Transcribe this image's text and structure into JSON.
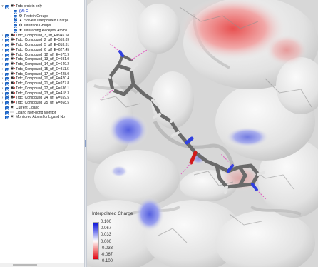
{
  "tree": {
    "rows": [
      {
        "label": "Trdc protein only",
        "twisty": "▾",
        "indent": 0,
        "icon": "ligand-icon",
        "checked": true
      },
      {
        "label": "(M) E",
        "twisty": "›",
        "indent": 1,
        "icon": "",
        "checked": true,
        "highlight": true
      },
      {
        "label": "Protein Groups",
        "twisty": "›",
        "indent": 1,
        "icon": "group-icon",
        "checked": true
      },
      {
        "label": "Solvent Interpolated Charge",
        "twisty": "",
        "indent": 1,
        "icon": "surface-icon",
        "checked": true
      },
      {
        "label": "Interface Groups",
        "twisty": "›",
        "indent": 1,
        "icon": "group-icon",
        "checked": true
      },
      {
        "label": "Interacting Receptor Atoms",
        "twisty": "",
        "indent": 1,
        "icon": "atoms-icon",
        "checked": true
      },
      {
        "label": "Trdc_Compound_3_uff_E=945.58",
        "twisty": "›",
        "indent": 0,
        "icon": "ligand-icon",
        "checked": true
      },
      {
        "label": "Trdc_Compound_2_uff_E=553.89",
        "twisty": "›",
        "indent": 0,
        "icon": "ligand-icon",
        "checked": true
      },
      {
        "label": "Trdc_Compound_5_uff_E=818.31",
        "twisty": "›",
        "indent": 0,
        "icon": "ligand-icon",
        "checked": true
      },
      {
        "label": "Trdc_Compound_6_uff_E=627.45",
        "twisty": "›",
        "indent": 0,
        "icon": "ligand-icon",
        "checked": true
      },
      {
        "label": "Trdc_Compound_12_uff_E=575.9",
        "twisty": "›",
        "indent": 0,
        "icon": "ligand-icon",
        "checked": true
      },
      {
        "label": "Trdc_Compound_13_uff_E=931.0",
        "twisty": "›",
        "indent": 0,
        "icon": "ligand-icon",
        "checked": true
      },
      {
        "label": "Trdc_Compound_14_uff_E=649.2",
        "twisty": "›",
        "indent": 0,
        "icon": "ligand-icon",
        "checked": true
      },
      {
        "label": "Trdc_Compound_15_uff_E=811.6",
        "twisty": "›",
        "indent": 0,
        "icon": "ligand-icon",
        "checked": true
      },
      {
        "label": "Trdc_Compound_17_uff_E=428.0",
        "twisty": "›",
        "indent": 0,
        "icon": "ligand-icon",
        "checked": true
      },
      {
        "label": "Trdc_Compound_20_uff_E=420.4",
        "twisty": "›",
        "indent": 0,
        "icon": "ligand-icon",
        "checked": true
      },
      {
        "label": "Trdc_Compound_21_uff_E=977.8",
        "twisty": "›",
        "indent": 0,
        "icon": "ligand-icon",
        "checked": true
      },
      {
        "label": "Trdc_Compound_22_uff_E=536.1",
        "twisty": "›",
        "indent": 0,
        "icon": "ligand-icon",
        "checked": true
      },
      {
        "label": "Trdc_Compound_23_uff_E=418.3",
        "twisty": "›",
        "indent": 0,
        "icon": "ligand-icon",
        "checked": true
      },
      {
        "label": "Trdc_Compound_24_uff_E=559.5",
        "twisty": "›",
        "indent": 0,
        "icon": "ligand-icon",
        "checked": true
      },
      {
        "label": "Trdc_Compound_25_uff_E=868.5",
        "twisty": "›",
        "indent": 0,
        "icon": "ligand-icon",
        "checked": true
      },
      {
        "label": "Current Ligand",
        "twisty": "",
        "indent": 0,
        "icon": "atoms-icon",
        "checked": true
      },
      {
        "label": "Ligand Non-bond Monitor",
        "twisty": "",
        "indent": 0,
        "icon": "monitor-icon",
        "checked": true
      },
      {
        "label": "Monitored Atoms for Ligand No",
        "twisty": "",
        "indent": 0,
        "icon": "atoms-icon",
        "checked": true
      }
    ]
  },
  "legend": {
    "title": "Interpolated Charge",
    "ticks": [
      "0.100",
      "0.067",
      "0.033",
      "0.000",
      "-0.033",
      "-0.067",
      "-0.100"
    ]
  },
  "colors": {
    "positive": "#0b13d8",
    "neutral": "#ffffff",
    "negative": "#e00010",
    "carbon": "#7a7a7a",
    "nitrogen": "#2a3fe0",
    "oxygen": "#d41a1a",
    "hydrogen": "#f2f2f2"
  }
}
